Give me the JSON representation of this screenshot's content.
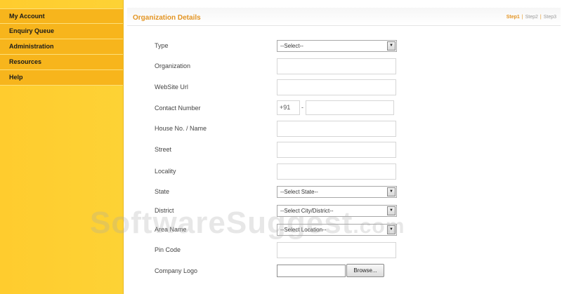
{
  "sidebar": {
    "items": [
      {
        "label": "My Account"
      },
      {
        "label": "Enquiry Queue"
      },
      {
        "label": "Administration"
      },
      {
        "label": "Resources"
      },
      {
        "label": "Help"
      }
    ]
  },
  "header": {
    "title": "Organization Details",
    "steps": [
      "Step1",
      "Step2",
      "Step3"
    ],
    "active_step": "Step1"
  },
  "form": {
    "type_label": "Type",
    "type_value": "--Select--",
    "organization_label": "Organization",
    "website_label": "WebSite Url",
    "contact_label": "Contact Number",
    "contact_prefix": "+91",
    "contact_separator": "-",
    "house_label": "House No. / Name",
    "street_label": "Street",
    "locality_label": "Locality",
    "state_label": "State",
    "state_value": "--Select State--",
    "district_label": "District",
    "district_value": "--Select City/District--",
    "area_label": "Area Name",
    "area_value": "--Select Location--",
    "pin_label": "Pin Code",
    "logo_label": "Company Logo",
    "browse_label": "Browse..."
  },
  "watermark": {
    "text": "SoftwareSuggest",
    "suffix": ".com"
  },
  "colors": {
    "sidebar": "#fdd235",
    "nav": "#f7b51c",
    "accent": "#e39422"
  }
}
